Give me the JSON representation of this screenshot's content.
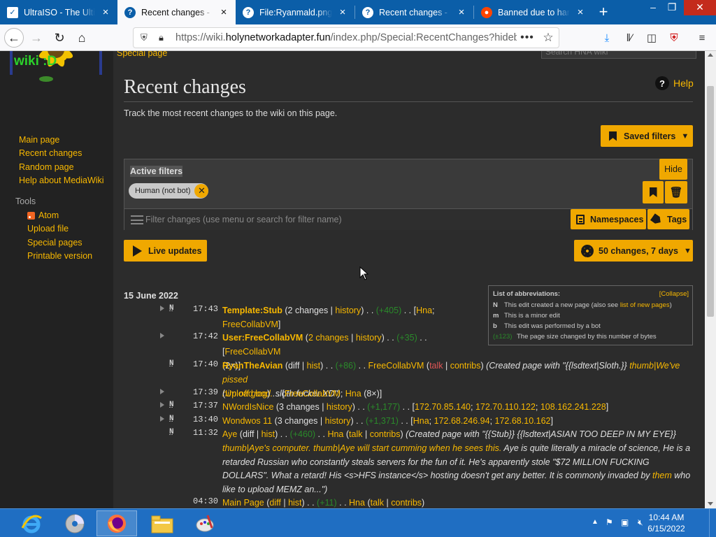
{
  "browser": {
    "tabs": [
      {
        "title": "UltraISO - The Ultimate ISO",
        "active": false,
        "icon": "ultraiso-icon"
      },
      {
        "title": "Recent changes - HNA wiki",
        "active": true,
        "icon": "help-circle-icon"
      },
      {
        "title": "File:Ryanmald.png - HNA wiki",
        "active": false,
        "icon": "help-circle-icon"
      },
      {
        "title": "Recent changes - HNA wiki",
        "active": false,
        "icon": "help-circle-icon"
      },
      {
        "title": "Banned due to harassment",
        "active": false,
        "icon": "reddit-icon"
      }
    ],
    "close_glyph": "×",
    "new_tab_glyph": "+",
    "url_prefix": "https://wiki.",
    "url_domain": "holynetworkadapter.fun",
    "url_suffix": "/index.php/Special:RecentChanges?hidebots",
    "url_more": "•••",
    "star": "☆"
  },
  "sidebar": {
    "logo_text": "wiki :D",
    "nav": [
      "Main page",
      "Recent changes",
      "Random page",
      "Help about MediaWiki"
    ],
    "tools_heading": "Tools",
    "tools": [
      "Atom",
      "Upload file",
      "Special pages",
      "Printable version"
    ]
  },
  "header": {
    "special_page_tab": "Special page",
    "search_placeholder": "Search HNA wiki"
  },
  "page": {
    "title": "Recent changes",
    "help": "Help",
    "intro": "Track the most recent changes to the wiki on this page.",
    "saved_filters": "Saved filters",
    "active_filters": "Active filters",
    "hide": "Hide",
    "filter_tag": "Human (not bot)",
    "filter_placeholder": "Filter changes (use menu or search for filter name)",
    "namespaces": "Namespaces",
    "tags": "Tags",
    "live_updates": "Live updates",
    "changes_summary": "50 changes, 7 days",
    "date_heading": "15 June 2022"
  },
  "legend": {
    "title": "List of abbreviations:",
    "collapse": "[Collapse]",
    "n_key": "N",
    "n_desc": "This edit created a new page (also see ",
    "n_link": "list of new pages",
    "n_end": ")",
    "m_key": "m",
    "m_desc": "This is a minor edit",
    "b_key": "b",
    "b_desc": "This edit was performed by a bot",
    "size_sample": "(±123)",
    "size_desc": "The page size changed by this number of bytes"
  },
  "changes": [
    {
      "time": "17:43",
      "flag": "N",
      "expandable": true
    },
    {
      "time": "17:42",
      "flag": "",
      "expandable": true
    },
    {
      "time": "17:40",
      "flag": "N",
      "expandable": false
    },
    {
      "time": "17:39",
      "flag": "",
      "expandable": true
    },
    {
      "time": "17:37",
      "flag": "N",
      "expandable": true
    },
    {
      "time": "13:40",
      "flag": "N",
      "expandable": true
    },
    {
      "time": "11:32",
      "flag": "N",
      "expandable": false
    },
    {
      "time": "04:30",
      "flag": "",
      "expandable": false
    }
  ],
  "taskbar": {
    "time": "10:44 AM",
    "date": "6/15/2022"
  }
}
